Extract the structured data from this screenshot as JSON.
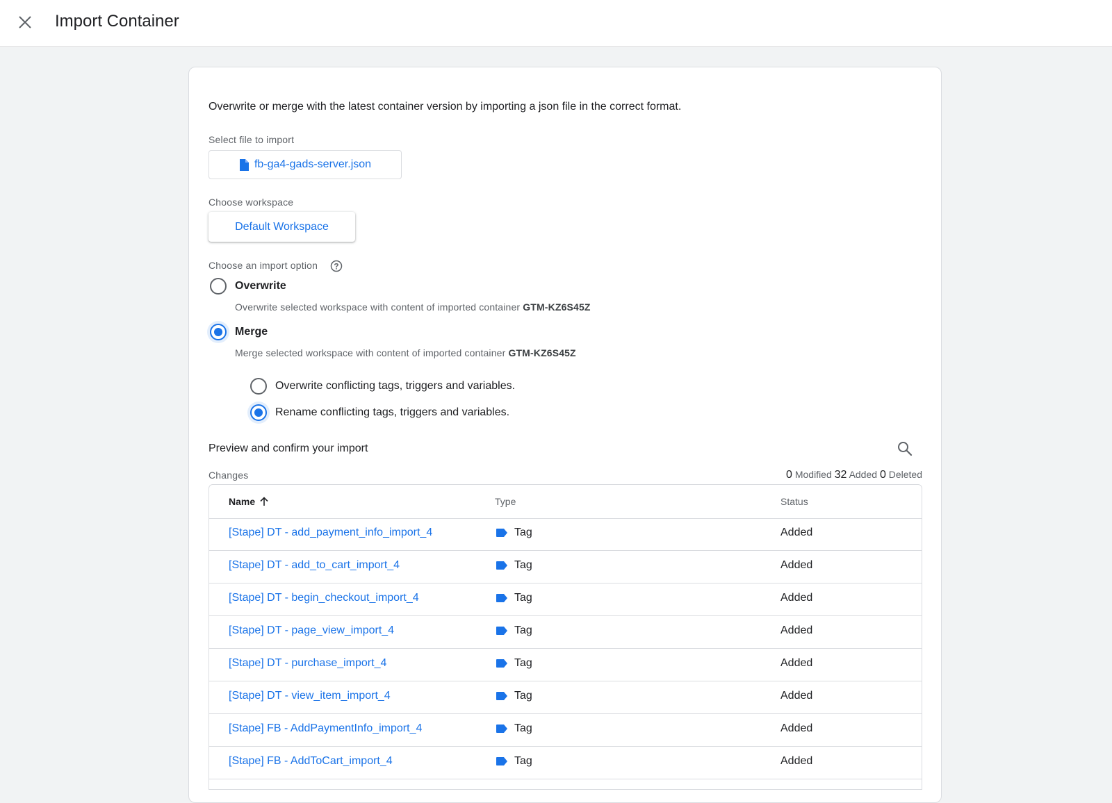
{
  "header": {
    "title": "Import Container",
    "close_icon": "close-icon"
  },
  "intro": "Overwrite or merge with the latest container version by importing a json file in the correct format.",
  "file": {
    "label": "Select file to import",
    "filename": "fb-ga4-gads-server.json",
    "icon": "file-icon"
  },
  "workspace": {
    "label": "Choose workspace",
    "value": "Default Workspace"
  },
  "import_option": {
    "label": "Choose an import option",
    "help_icon": "help-icon",
    "options": [
      {
        "title": "Overwrite",
        "desc_prefix": "Overwrite selected workspace with content of imported container",
        "container_id": "GTM-KZ6S45Z",
        "checked": false
      },
      {
        "title": "Merge",
        "desc_prefix": "Merge selected workspace with content of imported container",
        "container_id": "GTM-KZ6S45Z",
        "checked": true
      }
    ],
    "merge_options": [
      {
        "label": "Overwrite conflicting tags, triggers and variables.",
        "checked": false
      },
      {
        "label": "Rename conflicting tags, triggers and variables.",
        "checked": true
      }
    ]
  },
  "preview": {
    "title": "Preview and confirm your import",
    "search_icon": "search-icon",
    "changes_label": "Changes",
    "summary": {
      "modified_count": "0",
      "modified_label": "Modified",
      "added_count": "32",
      "added_label": "Added",
      "deleted_count": "0",
      "deleted_label": "Deleted"
    }
  },
  "table": {
    "columns": {
      "name": "Name",
      "type": "Type",
      "status": "Status"
    },
    "sort_icon": "arrow-up-icon",
    "tag_icon": "tag-icon",
    "rows": [
      {
        "name": "[Stape] DT - add_payment_info_import_4",
        "type": "Tag",
        "status": "Added"
      },
      {
        "name": "[Stape] DT - add_to_cart_import_4",
        "type": "Tag",
        "status": "Added"
      },
      {
        "name": "[Stape] DT - begin_checkout_import_4",
        "type": "Tag",
        "status": "Added"
      },
      {
        "name": "[Stape] DT - page_view_import_4",
        "type": "Tag",
        "status": "Added"
      },
      {
        "name": "[Stape] DT - purchase_import_4",
        "type": "Tag",
        "status": "Added"
      },
      {
        "name": "[Stape] DT - view_item_import_4",
        "type": "Tag",
        "status": "Added"
      },
      {
        "name": "[Stape] FB - AddPaymentInfo_import_4",
        "type": "Tag",
        "status": "Added"
      },
      {
        "name": "[Stape] FB - AddToCart_import_4",
        "type": "Tag",
        "status": "Added"
      }
    ]
  },
  "colors": {
    "accent": "#1a73e8",
    "background": "#f1f3f4",
    "text": "#202124",
    "muted": "#5f6368"
  }
}
